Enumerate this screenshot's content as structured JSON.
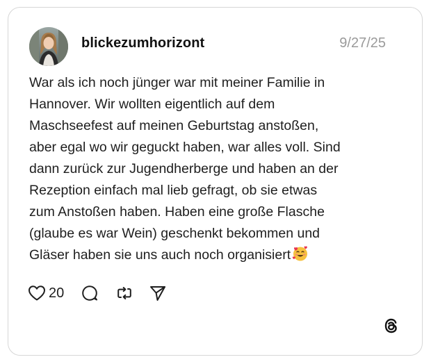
{
  "post": {
    "username": "blickezumhorizont",
    "date": "9/27/25",
    "text": "War als ich noch jünger war mit meiner Familie in\nHannover. Wir wollten eigentlich auf dem\nMaschseefest auf meinen Geburtstag anstoßen,\naber egal wo wir geguckt haben, war alles voll. Sind\ndann zurück zur Jugendherberge und haben an der\nRezeption einfach mal lieb gefragt, ob sie etwas\nzum Anstoßen haben. Haben eine große Flasche\n(glaube es war Wein) geschenkt bekommen und\nGläser haben sie uns auch noch organisiert",
    "emoji": "smiling-face-with-hearts",
    "like_count": "20"
  },
  "icons": {
    "like": "heart-icon",
    "reply": "speech-bubble-icon",
    "repost": "repost-arrows-icon",
    "share": "send-icon",
    "brand": "threads-logo"
  },
  "colors": {
    "text": "#1e1e1e",
    "muted": "#9a9a9a",
    "border": "#d6d6d6",
    "emoji_face": "#f7c13e",
    "emoji_hearts": "#e8364f"
  }
}
